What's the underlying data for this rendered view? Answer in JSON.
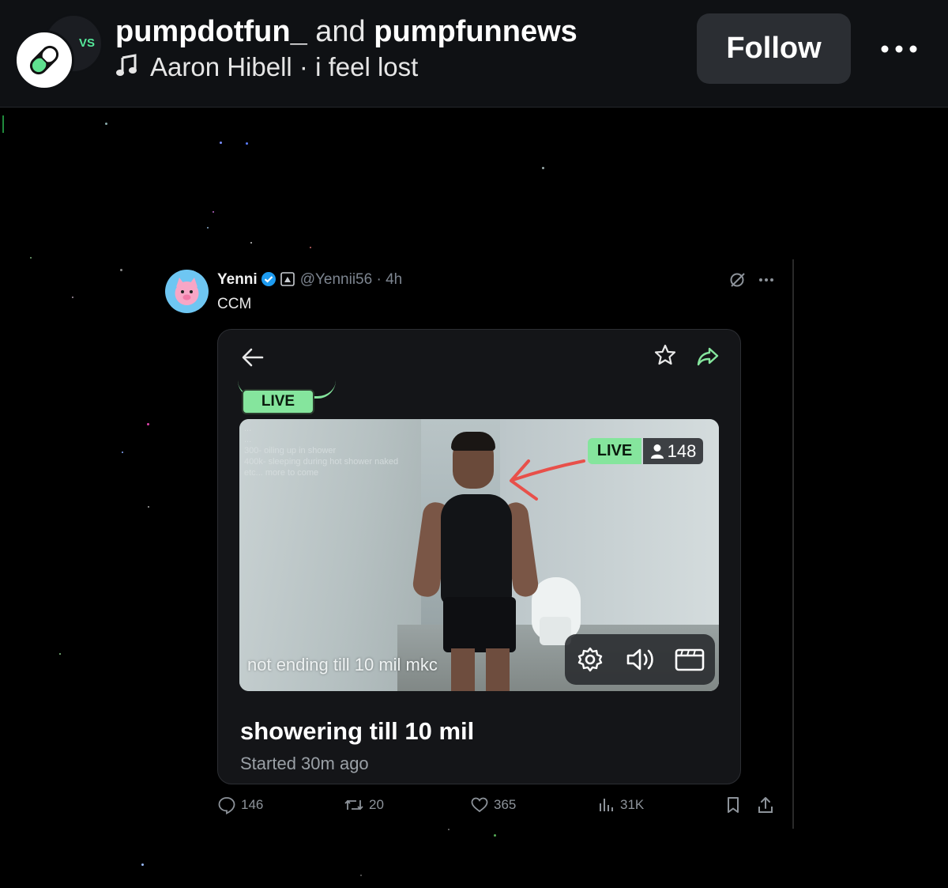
{
  "header": {
    "account_primary": "pumpdotfun_",
    "joiner": "and",
    "account_secondary": "pumpfunnews",
    "music_artist_track": "Aaron Hibell · i feel lost",
    "follow_label": "Follow",
    "avatar_badge": "VS",
    "icons": [
      "pill-icon",
      "music-note-icon",
      "more-icon"
    ]
  },
  "tweet": {
    "display_name": "Yenni",
    "handle_time": "@Yennii56 · 4h",
    "text": "CCM",
    "icons": [
      "verified-icon",
      "id-card-icon",
      "grok-icon",
      "more-icon"
    ]
  },
  "card": {
    "top_live_label": "LIVE",
    "live_label": "LIVE",
    "viewer_count": "148",
    "overlay_lines": [
      "...",
      "...",
      "300- oiling up in shower",
      "400k- sleeping during hot shower naked",
      "etc... more to come"
    ],
    "caption": "not ending till 10 mil mkc",
    "title": "showering till 10 mil",
    "subtitle": "Started 30m ago",
    "icons": [
      "back-arrow-icon",
      "star-icon",
      "share-icon",
      "settings-icon",
      "volume-icon",
      "clapperboard-icon"
    ],
    "accent_color": "#85e59d"
  },
  "actions": {
    "replies": "146",
    "reposts": "20",
    "likes": "365",
    "views": "31K",
    "icons": [
      "reply-icon",
      "repost-icon",
      "like-icon",
      "views-icon",
      "bookmark-icon",
      "upload-icon"
    ]
  },
  "colors": {
    "background": "#000000",
    "topbar": "#0f1114",
    "follow_button": "#2b2e33",
    "arrow_red": "#e8504a"
  }
}
